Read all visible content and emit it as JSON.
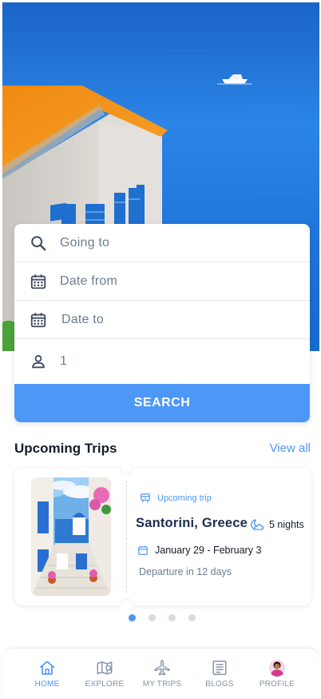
{
  "search": {
    "destination_placeholder": "Going to",
    "date_from_placeholder": "Date from",
    "date_to_placeholder": "Date to",
    "guests_value": "1",
    "button_label": "SEARCH"
  },
  "upcoming": {
    "title": "Upcoming Trips",
    "view_all": "View all",
    "trip": {
      "status": "Upcoming trip",
      "destination": "Santorini, Greece",
      "nights": "5 nights",
      "dates": "January 29 - February 3",
      "departure": "Departure in 12 days"
    },
    "carousel_pages": 4,
    "carousel_active": 0
  },
  "nav": {
    "items": [
      {
        "label": "HOME",
        "icon": "home-icon",
        "active": true
      },
      {
        "label": "EXPLORE",
        "icon": "map-icon",
        "active": false
      },
      {
        "label": "MY TRIPS",
        "icon": "airplane-icon",
        "active": false
      },
      {
        "label": "BLOGS",
        "icon": "newspaper-icon",
        "active": false
      },
      {
        "label": "PROFILE",
        "icon": "avatar-icon",
        "active": false
      }
    ]
  },
  "colors": {
    "accent": "#4d97f6",
    "text_dark": "#151c29",
    "text_muted": "#6a7c8f",
    "nav_inactive": "#8593a6"
  }
}
